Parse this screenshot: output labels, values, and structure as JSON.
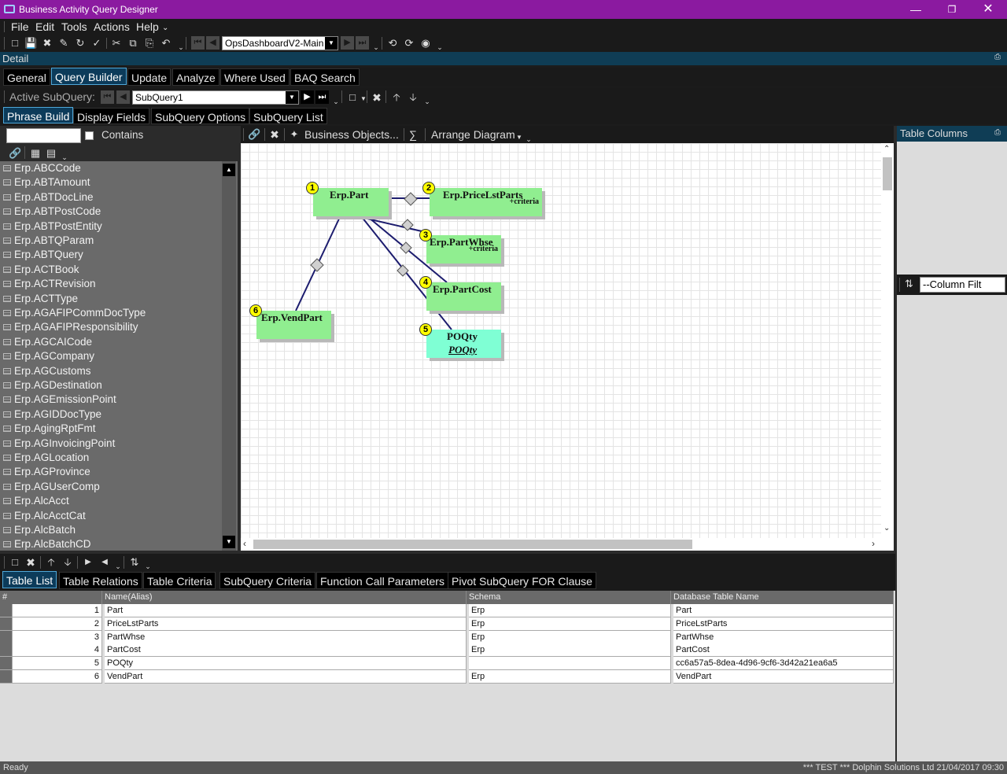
{
  "window": {
    "title": "Business Activity Query Designer"
  },
  "menu": {
    "file": "File",
    "edit": "Edit",
    "tools": "Tools",
    "actions": "Actions",
    "help": "Help"
  },
  "toolbar": {
    "dashboard_combo": "OpsDashboardV2-Main"
  },
  "detail": {
    "label": "Detail"
  },
  "main_tabs": [
    "General",
    "Query Builder",
    "Update",
    "Analyze",
    "Where Used",
    "BAQ Search"
  ],
  "subquery": {
    "label": "Active SubQuery:",
    "value": "SubQuery1"
  },
  "sub_tabs": [
    "Phrase Build",
    "Display Fields",
    "SubQuery Options",
    "SubQuery List"
  ],
  "left": {
    "contains_label": "Contains",
    "items": [
      "Erp.ABCCode",
      "Erp.ABTAmount",
      "Erp.ABTDocLine",
      "Erp.ABTPostCode",
      "Erp.ABTPostEntity",
      "Erp.ABTQParam",
      "Erp.ABTQuery",
      "Erp.ACTBook",
      "Erp.ACTRevision",
      "Erp.ACTType",
      "Erp.AGAFIPCommDocType",
      "Erp.AGAFIPResponsibility",
      "Erp.AGCAICode",
      "Erp.AGCompany",
      "Erp.AGCustoms",
      "Erp.AGDestination",
      "Erp.AGEmissionPoint",
      "Erp.AGIDDocType",
      "Erp.AgingRptFmt",
      "Erp.AGInvoicingPoint",
      "Erp.AGLocation",
      "Erp.AGProvince",
      "Erp.AGUserComp",
      "Erp.AlcAcct",
      "Erp.AlcAcctCat",
      "Erp.AlcBatch",
      "Erp.AlcBatchCD"
    ]
  },
  "diagram_toolbar": {
    "business_objects": "Business Objects...",
    "sigma": "∑",
    "arrange": "Arrange Diagram"
  },
  "diagram": {
    "tables": [
      {
        "num": "1",
        "name": "Erp.Part",
        "criteria": ""
      },
      {
        "num": "2",
        "name": "Erp.PriceLstParts",
        "criteria": "+criteria"
      },
      {
        "num": "3",
        "name": "Erp.PartWhse",
        "criteria": "+criteria"
      },
      {
        "num": "4",
        "name": "Erp.PartCost",
        "criteria": ""
      },
      {
        "num": "5",
        "name": "POQty",
        "criteria": "",
        "sub": "POQty"
      },
      {
        "num": "6",
        "name": "Erp.VendPart",
        "criteria": ""
      }
    ]
  },
  "right": {
    "header": "Table Columns",
    "filter": "--Column Filt"
  },
  "bottom_tabs": [
    "Table List",
    "Table Relations",
    "Table Criteria",
    "SubQuery Criteria",
    "Function Call Parameters",
    "Pivot SubQuery FOR Clause"
  ],
  "grid": {
    "headers": [
      "#",
      "Name(Alias)",
      "Schema",
      "Database Table Name"
    ],
    "rows": [
      [
        "1",
        "Part",
        "Erp",
        "Part"
      ],
      [
        "2",
        "PriceLstParts",
        "Erp",
        "PriceLstParts"
      ],
      [
        "3",
        "PartWhse",
        "Erp",
        "PartWhse"
      ],
      [
        "4",
        "PartCost",
        "Erp",
        "PartCost"
      ],
      [
        "5",
        "POQty",
        "",
        "cc6a57a5-8dea-4d96-9cf6-3d42a21ea6a5"
      ],
      [
        "6",
        "VendPart",
        "Erp",
        "VendPart"
      ]
    ]
  },
  "status": {
    "left": "Ready",
    "right": "*** TEST *** Dolphin Solutions Ltd  21/04/2017   09:30"
  },
  "colors": {
    "titlebar": "#8b1aa0",
    "detail_bar": "#0f3d55",
    "table_node": "#90ee90",
    "subquery_node": "#7fffd4",
    "badge": "#ffff00"
  }
}
